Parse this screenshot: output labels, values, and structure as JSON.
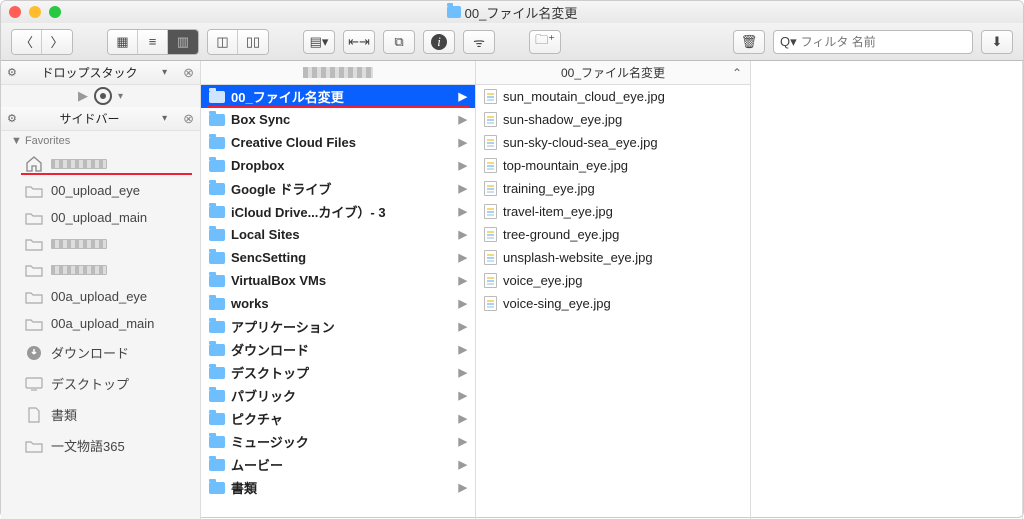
{
  "window": {
    "title": "00_ファイル名変更"
  },
  "toolbar": {
    "search_placeholder": "フィルタ 名前"
  },
  "sidebar": {
    "dropstack_label": "ドロップスタック",
    "sidebar_label": "サイドバー",
    "favorites_header": "Favorites",
    "items": [
      {
        "label": "",
        "icon": "home",
        "pixelated": true,
        "underline": true
      },
      {
        "label": "00_upload_eye",
        "icon": "folder"
      },
      {
        "label": "00_upload_main",
        "icon": "folder"
      },
      {
        "label": "",
        "icon": "folder",
        "pixelated": true
      },
      {
        "label": "",
        "icon": "folder",
        "pixelated": true
      },
      {
        "label": "00a_upload_eye",
        "icon": "folder"
      },
      {
        "label": "00a_upload_main",
        "icon": "folder"
      },
      {
        "label": "ダウンロード",
        "icon": "download"
      },
      {
        "label": "デスクトップ",
        "icon": "desktop"
      },
      {
        "label": "書類",
        "icon": "document"
      },
      {
        "label": "一文物語365",
        "icon": "folder"
      }
    ]
  },
  "column1": {
    "header_pixelated": true,
    "rows": [
      {
        "label": "00_ファイル名変更",
        "selected": true,
        "underline": true
      },
      {
        "label": "Box Sync"
      },
      {
        "label": "Creative Cloud Files"
      },
      {
        "label": "Dropbox"
      },
      {
        "label": "Google ドライブ"
      },
      {
        "label": "iCloud Drive...カイブ）- 3"
      },
      {
        "label": "Local Sites"
      },
      {
        "label": "SencSetting"
      },
      {
        "label": "VirtualBox VMs"
      },
      {
        "label": "works"
      },
      {
        "label": "アプリケーション"
      },
      {
        "label": "ダウンロード"
      },
      {
        "label": "デスクトップ"
      },
      {
        "label": "パブリック"
      },
      {
        "label": "ピクチャ"
      },
      {
        "label": "ミュージック"
      },
      {
        "label": "ムービー"
      },
      {
        "label": "書類"
      }
    ]
  },
  "column2": {
    "header": "00_ファイル名変更",
    "rows": [
      {
        "label": "sun_moutain_cloud_eye.jpg"
      },
      {
        "label": "sun-shadow_eye.jpg"
      },
      {
        "label": "sun-sky-cloud-sea_eye.jpg"
      },
      {
        "label": "top-mountain_eye.jpg"
      },
      {
        "label": "training_eye.jpg"
      },
      {
        "label": "travel-item_eye.jpg"
      },
      {
        "label": "tree-ground_eye.jpg"
      },
      {
        "label": "unsplash-website_eye.jpg"
      },
      {
        "label": "voice_eye.jpg"
      },
      {
        "label": "voice-sing_eye.jpg"
      }
    ]
  }
}
